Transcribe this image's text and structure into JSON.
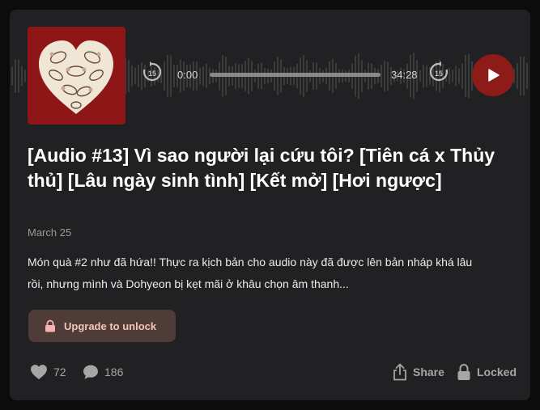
{
  "colors": {
    "accent": "#8d1b17",
    "card": "#212123",
    "cover": "#8e1616",
    "upgrade_bg": "#4f3b38",
    "upgrade_text": "#f6c6b6"
  },
  "player": {
    "current_time": "0:00",
    "duration": "34:28",
    "progress": 0,
    "skip_back_label": "15",
    "skip_forward_label": "15"
  },
  "post": {
    "title": "[Audio #13] Vì sao người lại cứu tôi? [Tiên cá x Thủy thủ] [Lâu ngày sinh tình] [Kết mở] [Hơi ngược]",
    "date": "March 25",
    "description": "Món quà #2 như đã hứa!! Thực ra kịch bản cho audio này đã được lên bản nháp khá lâu rồi, nhưng mình và Dohyeon bị kẹt mãi ở khâu chọn âm thanh..."
  },
  "upgrade": {
    "label": "Upgrade to unlock",
    "icon": "lock-icon"
  },
  "footer": {
    "likes": "72",
    "comments": "186",
    "share_label": "Share",
    "locked_label": "Locked",
    "icons": [
      "heart-icon",
      "comment-icon",
      "share-icon",
      "lock-icon"
    ]
  }
}
